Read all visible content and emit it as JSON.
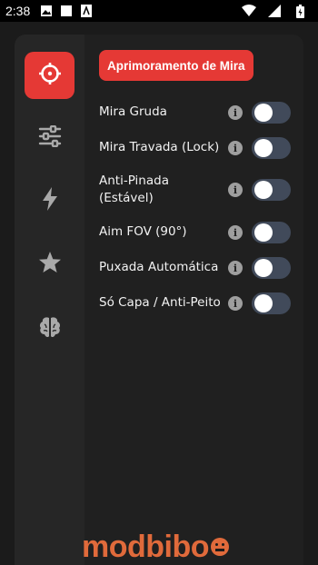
{
  "status_bar": {
    "time": "2:38",
    "left_icons": [
      "image-icon",
      "square-icon",
      "app-icon"
    ],
    "right_icons": [
      "wifi-icon",
      "signal-icon",
      "battery-icon"
    ]
  },
  "sidebar": {
    "items": [
      {
        "name": "crosshair-icon",
        "active": true
      },
      {
        "name": "sliders-icon",
        "active": false
      },
      {
        "name": "lightning-icon",
        "active": false
      },
      {
        "name": "star-icon",
        "active": false
      },
      {
        "name": "brain-icon",
        "active": false
      }
    ]
  },
  "main": {
    "header_label": "Aprimoramento de Mira",
    "rows": [
      {
        "label": "Mira Gruda",
        "enabled": false
      },
      {
        "label": "Mira Travada (Lock)",
        "enabled": false
      },
      {
        "label": "Anti-Pinada (Estável)",
        "enabled": false
      },
      {
        "label": "Aim FOV (90°)",
        "enabled": false
      },
      {
        "label": "Puxada Automática",
        "enabled": false
      },
      {
        "label": "Só Capa / Anti-Peito",
        "enabled": false
      }
    ]
  },
  "brand": {
    "logo_text": "modbibo"
  },
  "colors": {
    "accent": "#e53935",
    "toggle_off": "#414a5a",
    "brand": "#e06a3b"
  }
}
